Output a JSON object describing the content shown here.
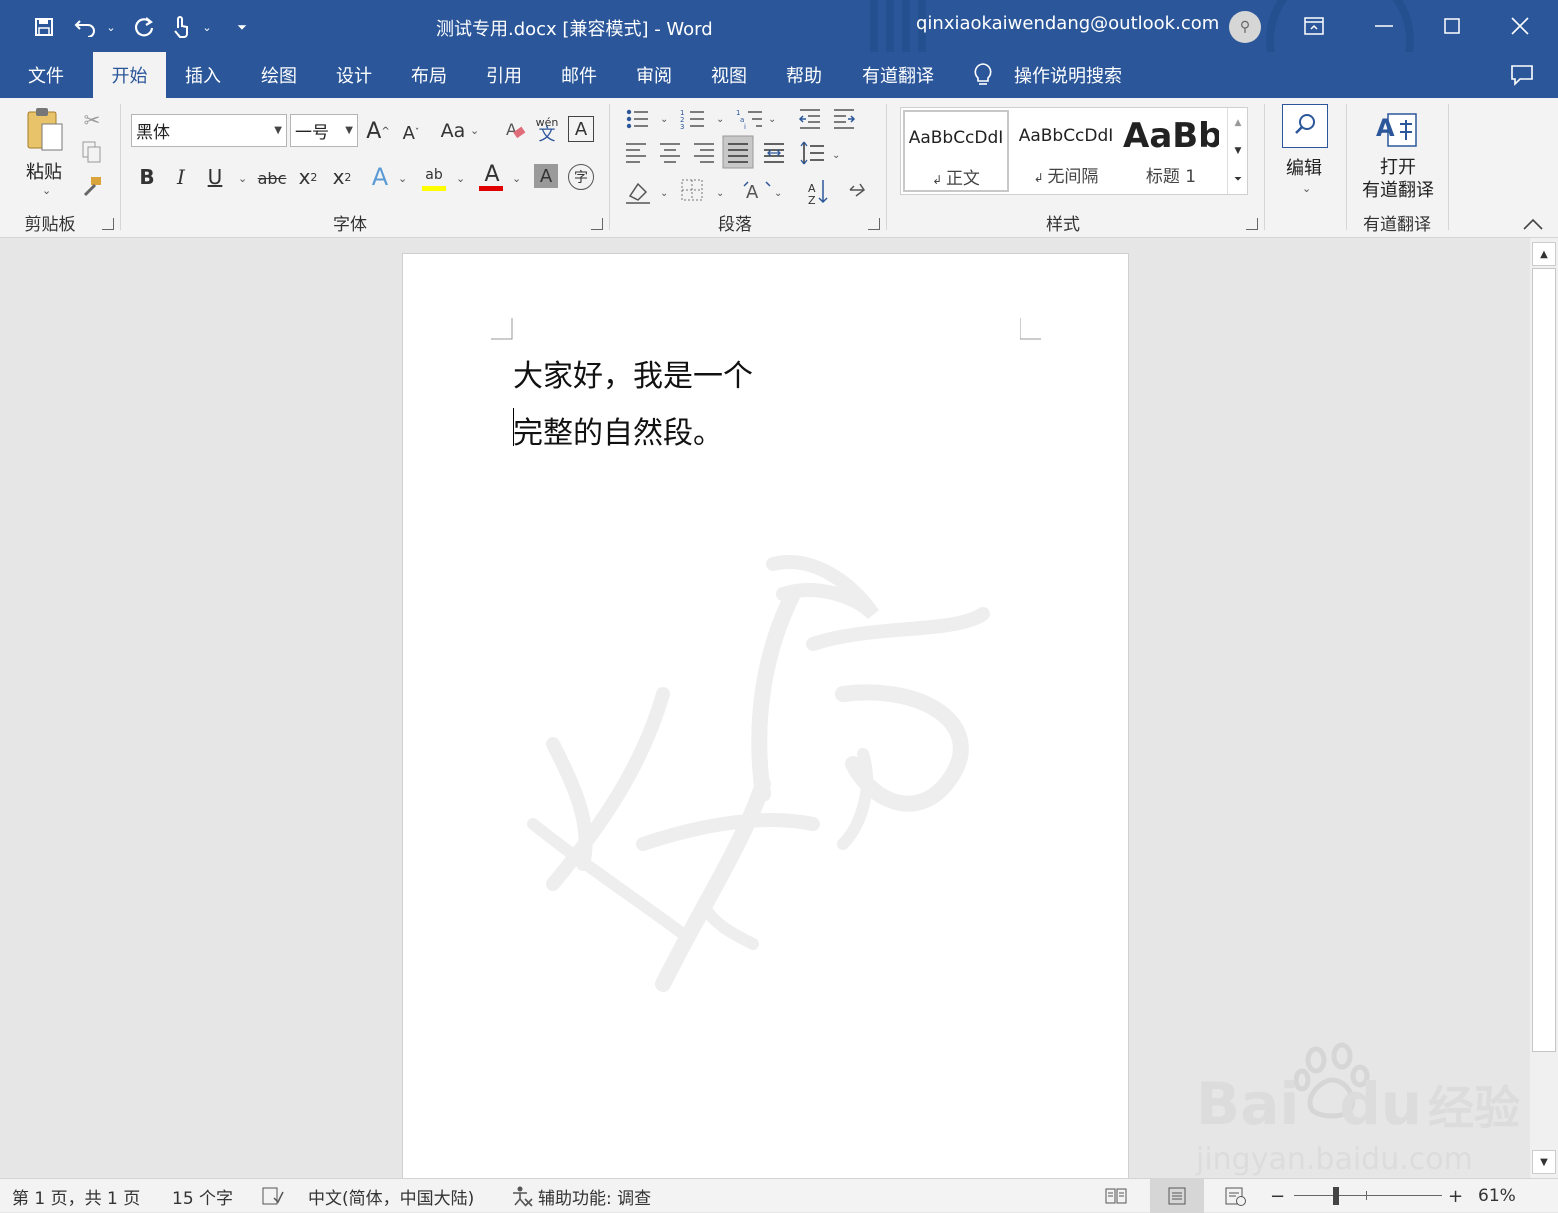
{
  "titlebar": {
    "doc_title": "测试专用.docx [兼容模式]  -  Word",
    "account": "qinxiaokaiwendang@outlook.com"
  },
  "tabs": [
    {
      "label": "文件"
    },
    {
      "label": "开始"
    },
    {
      "label": "插入"
    },
    {
      "label": "绘图"
    },
    {
      "label": "设计"
    },
    {
      "label": "布局"
    },
    {
      "label": "引用"
    },
    {
      "label": "邮件"
    },
    {
      "label": "审阅"
    },
    {
      "label": "视图"
    },
    {
      "label": "帮助"
    },
    {
      "label": "有道翻译"
    }
  ],
  "tell_me": "操作说明搜索",
  "ribbon": {
    "clipboard": {
      "paste": "粘贴",
      "label": "剪贴板"
    },
    "font": {
      "font_name": "黑体",
      "font_size": "一号",
      "label": "字体",
      "wen": "wén",
      "wen_char": "文"
    },
    "paragraph": {
      "label": "段落"
    },
    "styles": {
      "label": "样式",
      "items": [
        {
          "sample": "AaBbCcDdI",
          "name": "正文"
        },
        {
          "sample": "AaBbCcDdI",
          "name": "无间隔"
        },
        {
          "sample": "AaBb",
          "name": "标题 1"
        }
      ]
    },
    "editing": {
      "label": "编辑"
    },
    "youdao": {
      "button": "打开\n有道翻译",
      "label": "有道翻译"
    }
  },
  "document": {
    "line1": "大家好，我是一个",
    "line2": "完整的自然段。"
  },
  "statusbar": {
    "page": "第 1 页，共 1 页",
    "words": "15 个字",
    "language": "中文(简体，中国大陆)",
    "accessibility": "辅助功能: 调查",
    "zoom": "61%"
  },
  "watermark": {
    "text": "jingyan.baidu.com",
    "brand": "Bai",
    "brand2": "du",
    "jy": "经验"
  },
  "colors": {
    "accent": "#2b579a",
    "highlight": "#ffff00",
    "font_color": "#e00000"
  }
}
